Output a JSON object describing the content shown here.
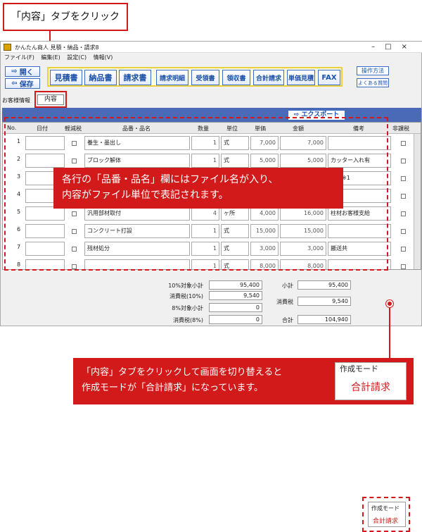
{
  "callout_top": {
    "text": "「内容」タブをクリック"
  },
  "window": {
    "title": "かんたん商人 見積・納品・請求8",
    "menu": [
      "ファイル(F)",
      "編集(E)",
      "設定(C)",
      "情報(V)"
    ],
    "open_label": "開く",
    "save_label": "保存",
    "doc_buttons": [
      "見積書",
      "納品書",
      "請求書",
      "請求明細",
      "受領書",
      "領収書",
      "合計請求",
      "単価見積",
      "FAX"
    ],
    "help_button": "操作方法",
    "faq_button": "よくある質問",
    "customer_info_label": "お客様情報",
    "content_tab": "内容",
    "export_button": "エクスポート"
  },
  "table": {
    "headers": [
      "No.",
      "日付",
      "軽減税",
      "品番・品名",
      "数量",
      "単位",
      "単価",
      "金額",
      "備考",
      "非課税"
    ],
    "rows": [
      {
        "no": "1",
        "name": "養生・墨出し",
        "qty": "1",
        "unit": "式",
        "price": "7,000",
        "amount": "7,000",
        "note": ""
      },
      {
        "no": "2",
        "name": "ブロック解体",
        "qty": "1",
        "unit": "式",
        "price": "5,000",
        "amount": "5,000",
        "note": "カッター入れ有"
      },
      {
        "no": "3",
        "name": "",
        "qty": "",
        "unit": "",
        "price": "",
        "amount": "",
        "note": "あり※1"
      },
      {
        "no": "4",
        "name": "",
        "qty": "",
        "unit": "",
        "price": "",
        "amount": "",
        "note": ""
      },
      {
        "no": "5",
        "name": "汎用部材取付",
        "qty": "4",
        "unit": "ヶ所",
        "price": "4,000",
        "amount": "16,000",
        "note": "柱材お客様支給"
      },
      {
        "no": "6",
        "name": "コンクリート打設",
        "qty": "1",
        "unit": "式",
        "price": "15,000",
        "amount": "15,000",
        "note": ""
      },
      {
        "no": "7",
        "name": "残材処分",
        "qty": "1",
        "unit": "式",
        "price": "3,000",
        "amount": "3,000",
        "note": "搬送共"
      },
      {
        "no": "8",
        "name": "",
        "qty": "1",
        "unit": "式",
        "price": "8,000",
        "amount": "8,000",
        "note": ""
      }
    ]
  },
  "overlay_text": [
    "各行の「品番・品名」欄にはファイル名が入り、",
    "内容がファイル単位で表記されます。"
  ],
  "totals": {
    "sub10_label": "10%対象小計",
    "sub10": "95,400",
    "tax10_label": "消費税(10%)",
    "tax10": "9,540",
    "sub8_label": "8%対象小計",
    "sub8": "0",
    "tax8_label": "消費税(8%)",
    "tax8": "0",
    "subtotal_label": "小計",
    "subtotal": "95,400",
    "tax_label": "消費税",
    "tax": "9,540",
    "total_label": "合計",
    "total": "104,940"
  },
  "mode": {
    "label": "作成モード",
    "value": "合計請求"
  },
  "bottom_callout": [
    "「内容」タブをクリックして画面を切り替えると",
    "作成モードが「合計請求」になっています。"
  ],
  "colors": {
    "accent": "#d21a1a",
    "header_blue": "#4a6ab8",
    "button_blue": "#1a4fa8"
  }
}
